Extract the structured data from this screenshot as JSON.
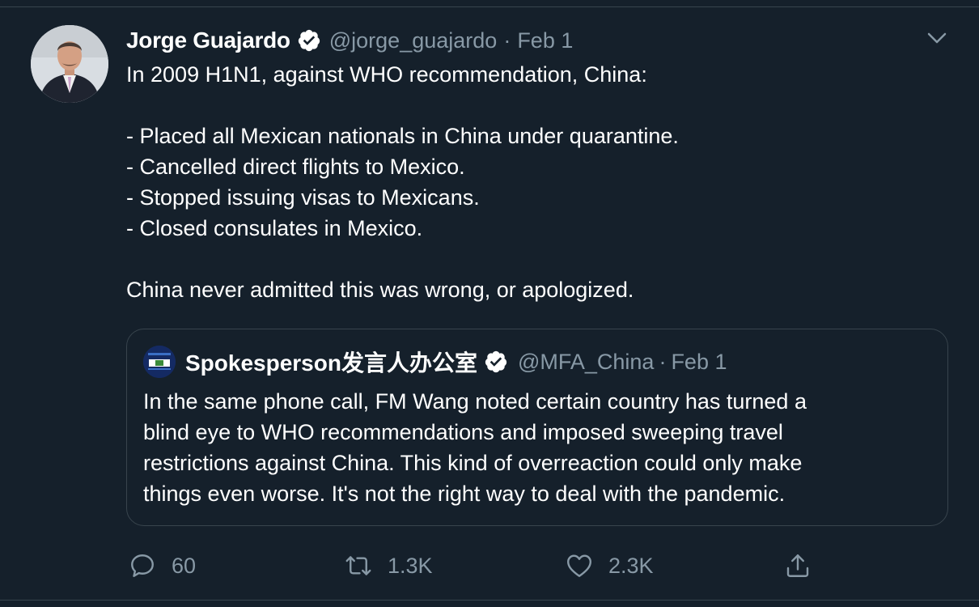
{
  "tweet": {
    "author": {
      "name": "Jorge Guajardo",
      "handle": "@jorge_guajardo",
      "date": "Feb 1",
      "separator": "·",
      "verified": true
    },
    "body_lines": [
      "In 2009 H1N1, against WHO recommendation, China:",
      "",
      "- Placed all Mexican nationals in China under quarantine.",
      "- Cancelled direct flights to Mexico.",
      "- Stopped issuing visas to Mexicans.",
      "- Closed consulates in Mexico.",
      "",
      "China never admitted this was wrong, or apologized."
    ],
    "quoted": {
      "name": "Spokesperson发言人办公室",
      "handle": "@MFA_China",
      "separator": "·",
      "date": "Feb 1",
      "verified": true,
      "text_lines": [
        "In the same phone call, FM Wang noted certain country has turned a",
        "blind eye to WHO recommendations and imposed sweeping travel",
        "restrictions against China. This kind of overreaction could only make",
        "things even worse. It's not the right way to deal with the pandemic."
      ]
    },
    "actions": {
      "replies": "60",
      "retweets": "1.3K",
      "likes": "2.3K"
    }
  },
  "icons": {
    "verified": "verified-badge-icon",
    "menu": "chevron-down-icon",
    "reply": "reply-icon",
    "retweet": "retweet-icon",
    "like": "heart-icon",
    "share": "share-icon"
  },
  "colors": {
    "background": "#15202b",
    "secondary_text": "#8899a6",
    "border": "#38444d",
    "primary_text": "#ffffff"
  }
}
